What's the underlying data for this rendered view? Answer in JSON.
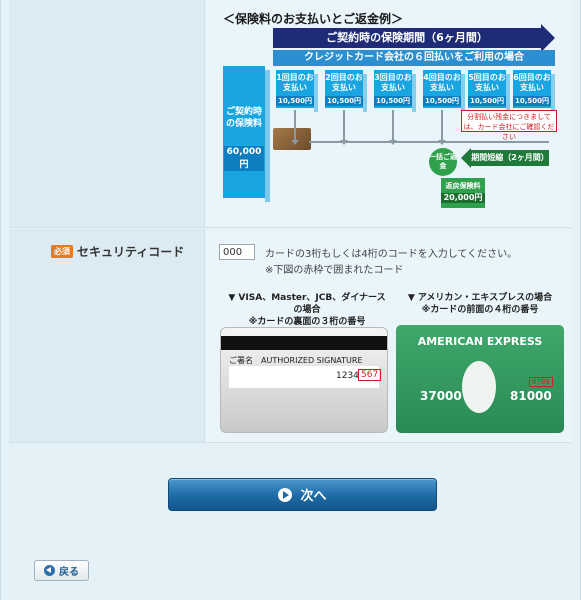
{
  "example": {
    "title": "＜保険料のお支払いとご返金例＞",
    "period_band": "ご契約時の保険期間（6ヶ月間）",
    "plan_band": "クレジットカード会社の６回払いをご利用の場合",
    "first_payment": {
      "label": "ご契約時の保険料",
      "amount": "60,000円"
    },
    "installments": [
      {
        "label": "1回目のお支払い",
        "amount": "10,500円"
      },
      {
        "label": "2回目のお支払い",
        "amount": "10,500円"
      },
      {
        "label": "3回目のお支払い",
        "amount": "10,500円"
      },
      {
        "label": "4回目のお支払い",
        "amount": "10,500円"
      },
      {
        "label": "5回目のお支払い",
        "amount": "10,500円"
      },
      {
        "label": "6回目のお支払い",
        "amount": "10,500円"
      }
    ],
    "note_red": "分割払い残金につきましては、カード会社にご確認ください",
    "refund_circle": "一括ご返金",
    "period_short": "期間短縮（2ヶ月間）",
    "refund_box": {
      "label": "返戻保険料",
      "amount": "20,000円"
    }
  },
  "security": {
    "required_badge": "必須",
    "label": "セキュリティコード",
    "input_value": "000",
    "help_text": "カードの3桁もしくは4桁のコードを入力してください。",
    "help_note": "※下図の赤枠で囲まれたコード",
    "visa_header": "▼ VISA、Master、JCB、ダイナースの場合",
    "visa_sub": "※カードの裏面の３桁の番号",
    "amex_header": "▼ アメリカン・エキスプレスの場合",
    "amex_sub": "※カードの前面の４桁の番号",
    "visa_card": {
      "sig_label": "ご署名　AUTHORIZED SIGNATURE",
      "number": "1234",
      "cvv": "567"
    },
    "amex_card": {
      "brand": "AMERICAN EXPRESS",
      "num1": "37000",
      "num2": "81000",
      "cvv": "6789"
    }
  },
  "buttons": {
    "next": "次へ",
    "back": "戻る"
  }
}
